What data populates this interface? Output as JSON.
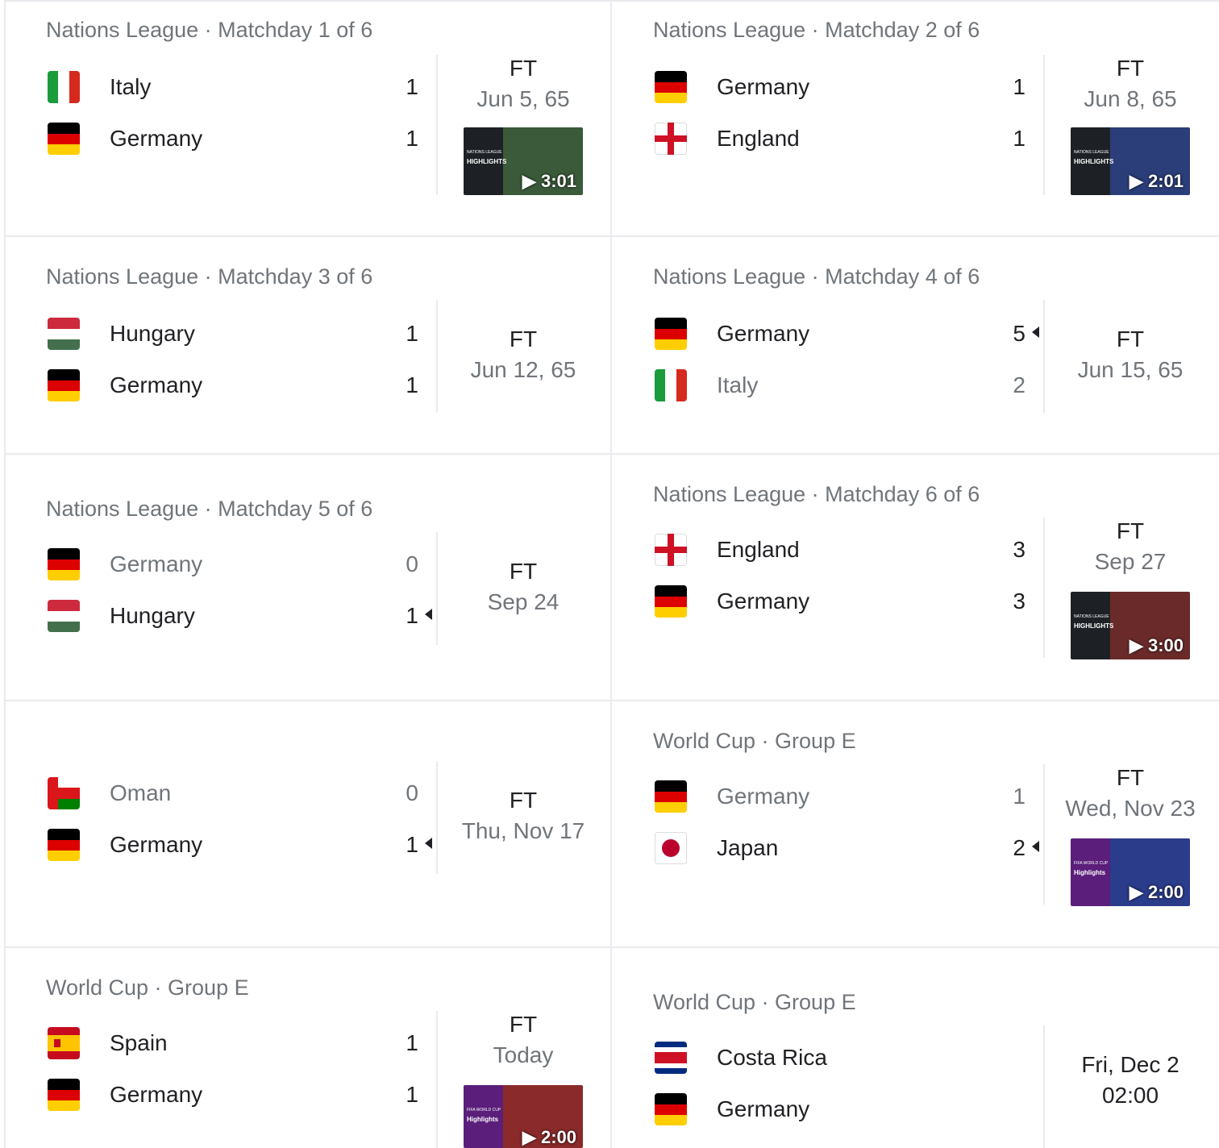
{
  "matches": [
    {
      "header": "Nations League · Matchday 1 of 6",
      "home": {
        "name": "Italy",
        "score": "1",
        "flag": "italy-flag"
      },
      "away": {
        "name": "Germany",
        "score": "1",
        "flag": "germany-flag"
      },
      "status": "FT",
      "date": "Jun 5, 65",
      "video": {
        "duration": "3:01",
        "label": "HIGHLIGHTS"
      }
    },
    {
      "header": "Nations League · Matchday 2 of 6",
      "home": {
        "name": "Germany",
        "score": "1",
        "flag": "germany-flag"
      },
      "away": {
        "name": "England",
        "score": "1",
        "flag": "england-flag"
      },
      "status": "FT",
      "date": "Jun 8, 65",
      "video": {
        "duration": "2:01",
        "label": "HIGHLIGHTS"
      }
    },
    {
      "header": "Nations League · Matchday 3 of 6",
      "home": {
        "name": "Hungary",
        "score": "1",
        "flag": "hungary-flag"
      },
      "away": {
        "name": "Germany",
        "score": "1",
        "flag": "germany-flag"
      },
      "status": "FT",
      "date": "Jun 12, 65"
    },
    {
      "header": "Nations League · Matchday 4 of 6",
      "home": {
        "name": "Germany",
        "score": "5",
        "flag": "germany-flag",
        "winner": true
      },
      "away": {
        "name": "Italy",
        "score": "2",
        "flag": "italy-flag"
      },
      "status": "FT",
      "date": "Jun 15, 65"
    },
    {
      "header": "Nations League · Matchday 5 of 6",
      "home": {
        "name": "Germany",
        "score": "0",
        "flag": "germany-flag"
      },
      "away": {
        "name": "Hungary",
        "score": "1",
        "flag": "hungary-flag",
        "winner": true
      },
      "status": "FT",
      "date": "Sep 24"
    },
    {
      "header": "Nations League · Matchday 6 of 6",
      "home": {
        "name": "England",
        "score": "3",
        "flag": "england-flag"
      },
      "away": {
        "name": "Germany",
        "score": "3",
        "flag": "germany-flag"
      },
      "status": "FT",
      "date": "Sep 27",
      "video": {
        "duration": "3:00",
        "label": "HIGHLIGHTS"
      }
    },
    {
      "header": "",
      "home": {
        "name": "Oman",
        "score": "0",
        "flag": "oman-flag"
      },
      "away": {
        "name": "Germany",
        "score": "1",
        "flag": "germany-flag",
        "winner": true
      },
      "status": "FT",
      "date": "Thu, Nov 17"
    },
    {
      "header": "World Cup · Group E",
      "home": {
        "name": "Germany",
        "score": "1",
        "flag": "germany-flag"
      },
      "away": {
        "name": "Japan",
        "score": "2",
        "flag": "japan-flag",
        "winner": true
      },
      "status": "FT",
      "date": "Wed, Nov 23",
      "video": {
        "duration": "2:00",
        "label": "Highlights"
      }
    },
    {
      "header": "World Cup · Group E",
      "home": {
        "name": "Spain",
        "score": "1",
        "flag": "spain-flag"
      },
      "away": {
        "name": "Germany",
        "score": "1",
        "flag": "germany-flag"
      },
      "status": "FT",
      "date": "Today",
      "video": {
        "duration": "2:00",
        "label": "Highlights"
      }
    },
    {
      "header": "World Cup · Group E",
      "home": {
        "name": "Costa Rica",
        "score": "",
        "flag": "costa-rica-flag"
      },
      "away": {
        "name": "Germany",
        "score": "",
        "flag": "germany-flag"
      },
      "status": "",
      "date": "Fri, Dec 2",
      "time": "02:00"
    }
  ]
}
